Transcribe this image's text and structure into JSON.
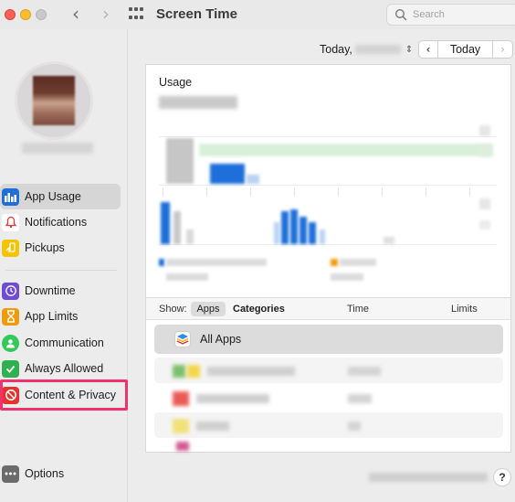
{
  "window": {
    "title": "Screen Time",
    "search_placeholder": "Search"
  },
  "sidebar": {
    "items": [
      {
        "label": "App Usage",
        "icon": "bar-chart-icon",
        "color": "#1e6fd9",
        "active": true
      },
      {
        "label": "Notifications",
        "icon": "bell-icon",
        "color": "#e53935"
      },
      {
        "label": "Pickups",
        "icon": "pickups-icon",
        "color": "#f5c400"
      },
      {
        "label": "Downtime",
        "icon": "moon-clock-icon",
        "color": "#6e4cd6"
      },
      {
        "label": "App Limits",
        "icon": "hourglass-icon",
        "color": "#f29b0a"
      },
      {
        "label": "Communication",
        "icon": "person-bubble-icon",
        "color": "#34c759"
      },
      {
        "label": "Always Allowed",
        "icon": "checkmark-shield-icon",
        "color": "#30b050"
      },
      {
        "label": "Content & Privacy",
        "icon": "restriction-icon",
        "color": "#e5322d"
      },
      {
        "label": "Options",
        "icon": "ellipsis-icon",
        "color": "#6b6b6b"
      }
    ],
    "highlight_color": "#f1306e"
  },
  "date_bar": {
    "date_label": "Today,",
    "today_button": "Today"
  },
  "usage": {
    "title": "Usage"
  },
  "list": {
    "show_label": "Show:",
    "apps_tab": "Apps",
    "categories_tab": "Categories",
    "time_header": "Time",
    "limits_header": "Limits",
    "all_apps_label": "All Apps"
  },
  "footer": {
    "help": "?"
  },
  "colors": {
    "accent_blue": "#1e6fd9"
  }
}
